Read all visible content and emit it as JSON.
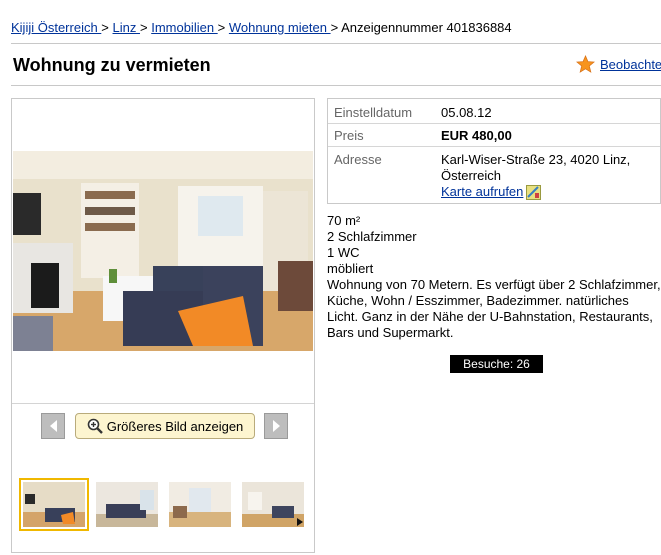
{
  "breadcrumb": {
    "items": [
      "Kijiji Österreich ",
      "Linz ",
      "Immobilien ",
      "Wohnung mieten "
    ],
    "separator": ">",
    "current": "Anzeigennummer 401836884"
  },
  "title": "Wohnung zu vermieten",
  "watch": {
    "label": "Beobachte",
    "icon": "star-icon"
  },
  "gallery": {
    "enlarge_label": "Größeres Bild anzeigen",
    "thumbnail_count": 4,
    "selected_thumbnail": 1
  },
  "details": {
    "date_label": "Einstelldatum",
    "date_value": "05.08.12",
    "price_label": "Preis",
    "price_value": "EUR 480,00",
    "address_label": "Adresse",
    "address_line1": "Karl-Wiser-Straße 23, 4020 Linz,",
    "address_line2": "Österreich",
    "map_link": "Karte aufrufen"
  },
  "description": {
    "area": "70 m²",
    "bedrooms": "2 Schlafzimmer",
    "wc": "1 WC",
    "furnished": "möbliert",
    "text": "Wohnung von 70 Metern. Es verfügt über 2 Schlafzimmer, Küche, Wohn / Esszimmer, Badezimmer. natürliches Licht. Ganz in der Nähe der U-Bahnstation, Restaurants, Bars und Supermarkt."
  },
  "visits": "Besuche: 26",
  "colors": {
    "link": "#00339a",
    "star": "#f7941d",
    "enlarge_bg": "#fdf5d0",
    "selected_thumb": "#f0b800"
  }
}
